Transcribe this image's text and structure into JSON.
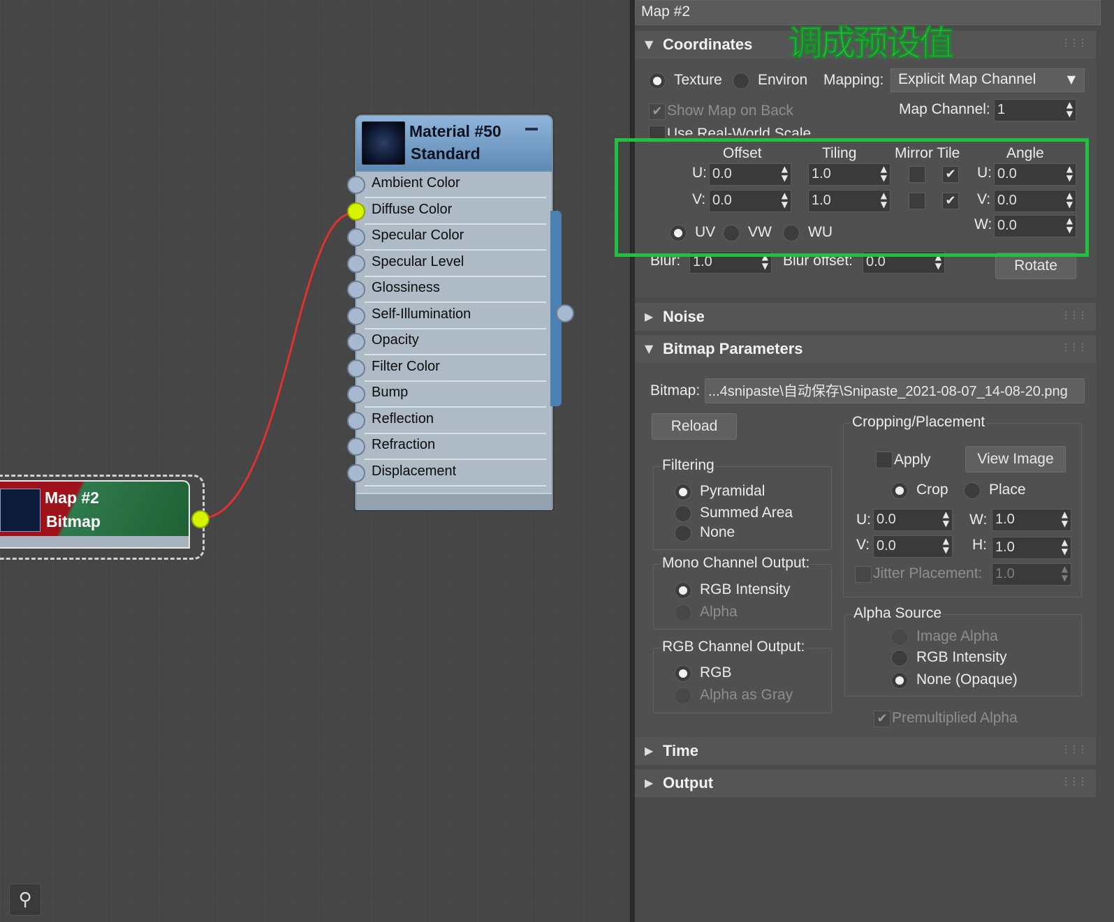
{
  "panel": {
    "title": "Map #2",
    "annotation": "调成预设值",
    "colors": {
      "highlight": "#22c040",
      "active_socket": "#d6f400",
      "wire": "#e03030"
    }
  },
  "material_node": {
    "title": "Material #50",
    "subtitle": "Standard",
    "slots": [
      "Ambient Color",
      "Diffuse Color",
      "Specular Color",
      "Specular Level",
      "Glossiness",
      "Self-Illumination",
      "Opacity",
      "Filter Color",
      "Bump",
      "Reflection",
      "Refraction",
      "Displacement"
    ],
    "connected_slot": "Diffuse Color"
  },
  "map_node": {
    "title": "Map #2",
    "subtitle": "Bitmap"
  },
  "coordinates": {
    "header": "Coordinates",
    "texture_label": "Texture",
    "environ_label": "Environ",
    "mapping_label": "Mapping:",
    "mapping_value": "Explicit Map Channel",
    "show_map_on_back": "Show Map on Back",
    "use_real_world_scale": "Use Real-World Scale",
    "map_channel_label": "Map Channel:",
    "map_channel_value": "1",
    "col_offset": "Offset",
    "col_tiling": "Tiling",
    "col_mirror_tile": "Mirror Tile",
    "col_angle": "Angle",
    "u_label": "U:",
    "v_label": "V:",
    "w_label": "W:",
    "offset_u": "0.0",
    "offset_v": "0.0",
    "tiling_u": "1.0",
    "tiling_v": "1.0",
    "angle_u": "0.0",
    "angle_v": "0.0",
    "angle_w": "0.0",
    "uv": "UV",
    "vw": "VW",
    "wu": "WU",
    "blur_label": "Blur:",
    "blur_value": "1.0",
    "blur_offset_label": "Blur offset:",
    "blur_offset_value": "0.0",
    "rotate": "Rotate"
  },
  "noise": {
    "header": "Noise"
  },
  "bitmap_params": {
    "header": "Bitmap Parameters",
    "bitmap_label": "Bitmap:",
    "bitmap_path": "...4snipaste\\自动保存\\Snipaste_2021-08-07_14-08-20.png",
    "reload": "Reload",
    "filtering": "Filtering",
    "pyramidal": "Pyramidal",
    "summed_area": "Summed Area",
    "none": "None",
    "mono_channel_output": "Mono Channel Output:",
    "rgb_intensity": "RGB Intensity",
    "alpha": "Alpha",
    "rgb_channel_output": "RGB Channel Output:",
    "rgb": "RGB",
    "alpha_as_gray": "Alpha as Gray",
    "cropping_placement": "Cropping/Placement",
    "apply": "Apply",
    "view_image": "View Image",
    "crop": "Crop",
    "place": "Place",
    "u_label": "U:",
    "v_label": "V:",
    "w_label": "W:",
    "h_label": "H:",
    "crop_u": "0.0",
    "crop_v": "0.0",
    "crop_w": "1.0",
    "crop_h": "1.0",
    "jitter_placement": "Jitter Placement:",
    "jitter_value": "1.0",
    "alpha_source": "Alpha Source",
    "image_alpha": "Image Alpha",
    "alpha_rgb_intensity": "RGB Intensity",
    "none_opaque": "None (Opaque)",
    "premultiplied_alpha": "Premultiplied Alpha"
  },
  "time": {
    "header": "Time"
  },
  "output": {
    "header": "Output"
  },
  "icons": [
    "binoculars-icon",
    "collapse-icon",
    "expand-triangle-icon",
    "grip-icon",
    "checkmark-icon",
    "dropdown-arrow-icon",
    "spinner-arrows-icon"
  ]
}
